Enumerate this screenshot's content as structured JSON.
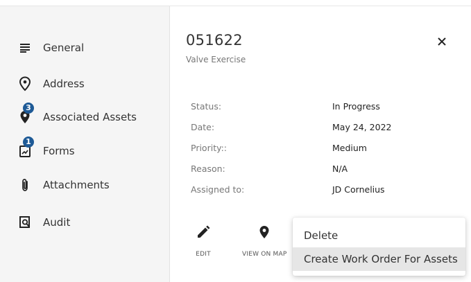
{
  "sidebar": {
    "items": [
      {
        "label": "General",
        "icon": "list-icon",
        "badge": null
      },
      {
        "label": "Address",
        "icon": "location-icon",
        "badge": null
      },
      {
        "label": "Associated Assets",
        "icon": "map-pin-icon",
        "badge": "3"
      },
      {
        "label": "Forms",
        "icon": "form-icon",
        "badge": "1"
      },
      {
        "label": "Attachments",
        "icon": "paperclip-icon",
        "badge": null
      },
      {
        "label": "Audit",
        "icon": "audit-icon",
        "badge": null
      }
    ]
  },
  "header": {
    "title": "051622",
    "subtitle": "Valve Exercise",
    "close_icon": "close-icon"
  },
  "details": [
    {
      "label": "Status:",
      "value": "In Progress"
    },
    {
      "label": "Date:",
      "value": "May 24, 2022"
    },
    {
      "label": "Priority::",
      "value": "Medium"
    },
    {
      "label": "Reason:",
      "value": "N/A"
    },
    {
      "label": "Assigned to:",
      "value": "JD Cornelius"
    }
  ],
  "actions": {
    "edit_label": "EDIT",
    "view_on_map_label": "VIEW ON MAP"
  },
  "menu": {
    "items": [
      "Delete",
      "Create Work Order For Assets"
    ]
  },
  "colors": {
    "badge": "#1e5a96",
    "sidebar_bg": "#f5f5f5",
    "menu_hover": "#e6e6e6"
  }
}
